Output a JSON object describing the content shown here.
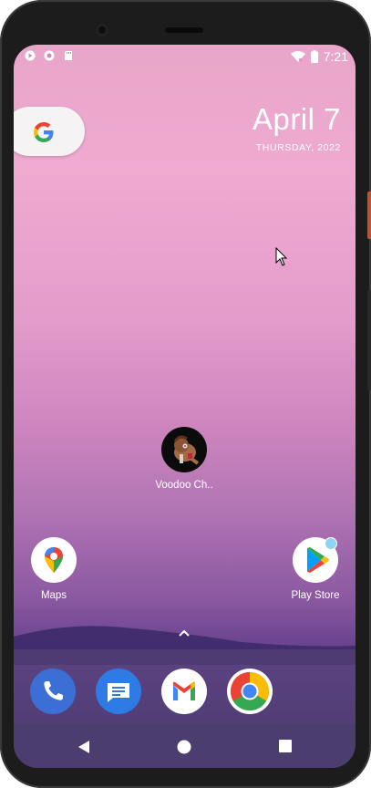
{
  "status_bar": {
    "time": "7:21",
    "left_icons": [
      "play-protect-icon",
      "sync-icon",
      "sd-card-icon"
    ],
    "right_icons": [
      "wifi-icon",
      "battery-icon"
    ]
  },
  "widget": {
    "date": "April 7",
    "weekday": "THURSDAY, 2022"
  },
  "apps": {
    "voodoo": {
      "label": "Voodoo Ch.."
    },
    "maps": {
      "label": "Maps"
    },
    "play_store": {
      "label": "Play Store"
    }
  },
  "dock": [
    "Phone",
    "Messages",
    "Gmail",
    "Chrome"
  ],
  "navigation": [
    "back-icon",
    "home-icon",
    "recents-icon"
  ],
  "colors": {
    "google_blue": "#4285F4",
    "google_red": "#EA4335",
    "google_yellow": "#FBBC05",
    "google_green": "#34A853",
    "wallpaper_top": "#efaad0",
    "wallpaper_bottom": "#3b2a67"
  }
}
